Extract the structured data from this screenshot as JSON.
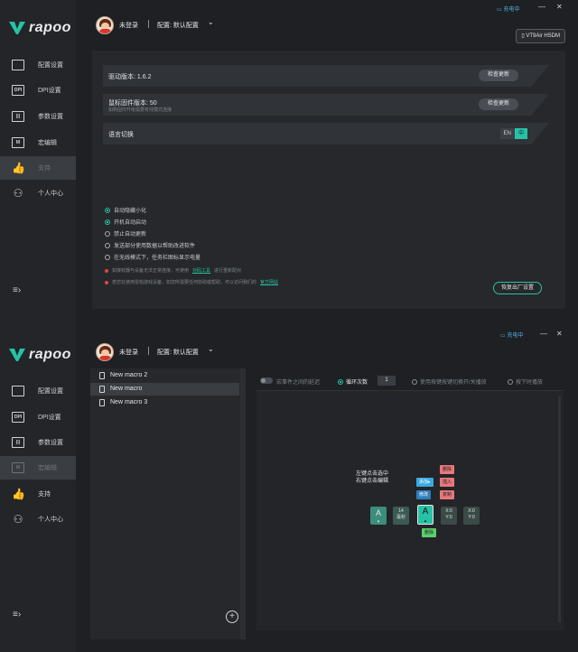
{
  "window1": {
    "user": {
      "name": "未登录",
      "config": "配置: 默认配置"
    },
    "charging": "充电中",
    "device": "VT9Air HSDM",
    "nav": [
      {
        "label": "配置设置",
        "icon": "config-icon",
        "glyph": ""
      },
      {
        "label": "DPI设置",
        "icon": "dpi-icon",
        "glyph": "DPI"
      },
      {
        "label": "参数设置",
        "icon": "params-icon",
        "glyph": "|||"
      },
      {
        "label": "宏编辑",
        "icon": "macro-icon",
        "glyph": "M"
      },
      {
        "label": "支持",
        "icon": "thumbs-up-icon",
        "glyph": "👍"
      },
      {
        "label": "个人中心",
        "icon": "person-icon",
        "glyph": "⚇"
      }
    ],
    "rows": [
      {
        "title": "驱动版本: 1.6.2",
        "sub": "",
        "button": "检查更新"
      },
      {
        "title": "鼠标固件版本: 50",
        "sub": "如购固件升级需要有线模式连接",
        "button": "检查更新"
      },
      {
        "title": "语言切换",
        "sub": "",
        "button": ""
      }
    ],
    "lang": {
      "en": "EN",
      "zh": "中"
    },
    "options": [
      {
        "label": "自动隐藏小化",
        "on": true
      },
      {
        "label": "开机自动启动",
        "on": true
      },
      {
        "label": "禁止自动更新",
        "on": false
      },
      {
        "label": "发送部分使用数据以帮助改进软件",
        "on": false
      },
      {
        "label": "在无线模式下，任务栏图标显示电量",
        "on": false
      }
    ],
    "notes": [
      {
        "text": "如接收器与设备无法正常连接，可使用",
        "link": "对码工具",
        "tail": "进行重新配对"
      },
      {
        "text": "若您在使用雷柏游戏设备，如您所需要任何协助或帮助，可以访问我们的",
        "link": "官方网站",
        "tail": ""
      }
    ],
    "reset": "恢复出厂设置"
  },
  "window2": {
    "user": {
      "name": "未登录",
      "config": "配置: 默认配置"
    },
    "charging": "充电中",
    "macros": [
      "New macro 2",
      "New macro",
      "New macro 3"
    ],
    "options": {
      "record_interval": "宏事件之间的延迟",
      "loop": "循环次数",
      "loop_count": "1",
      "until_release": "使用按键按键切换开/关播放",
      "hold": "按下时播放"
    },
    "hint": [
      "左键点击选中",
      "右键点击编辑"
    ],
    "chips": {
      "delete": "删除",
      "insert": "插入",
      "copy": "复制",
      "add": "添加▸",
      "edit": "修改",
      "paste": "粘贴",
      "remove": "删除"
    },
    "keys": [
      {
        "top": "A",
        "bottom": "▾"
      },
      {
        "top": "14",
        "bottom": "毫秒"
      },
      {
        "top": "A",
        "bottom": "▴"
      },
      {
        "top": "X:0",
        "bottom": "Y:0"
      },
      {
        "top": "X:0",
        "bottom": "Y:0"
      }
    ]
  },
  "colors": {
    "accent": "#26c2a6",
    "bg": "#1e2023",
    "sidebar": "#232528",
    "danger": "#e04848"
  }
}
